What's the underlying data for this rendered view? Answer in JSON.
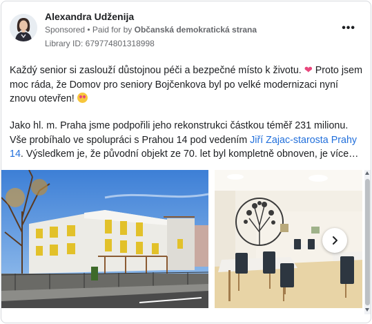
{
  "advertiser": {
    "name": "Alexandra Udženija",
    "sponsored": "Sponsored",
    "paid_for_prefix": " • Paid for by ",
    "paid_for_by": "Občanská demokratická strana",
    "library_id": "Library ID: 679774801318998"
  },
  "post": {
    "p1_text": "Každý senior si zaslouží důstojnou péči a bezpečné místo k životu. ",
    "p1_text2": " Proto jsem moc ráda, že Domov pro seniory Bojčenkova byl po velké modernizaci nyní znovu otevřen! ",
    "p2_text": "Jako hl. m. Praha jsme podpořili jeho rekonstrukci částkou téměř 231 milionu. Vše probíhalo ve spolupráci s Prahou 14 pod vedením ",
    "p2_link": "Jiří Zajac-starosta Prahy 14",
    "p2_text2": ". Výsledkem je, že původní objekt ze 70. let byl kompletně obnoven, je více…"
  },
  "icons": {
    "more": "more-options-icon",
    "heart": "heart-emoji-icon",
    "face": "heart-eyes-emoji-icon",
    "next": "chevron-right-icon"
  },
  "colors": {
    "link": "#216fdb",
    "text": "#1c1e21",
    "meta": "#65676b"
  }
}
